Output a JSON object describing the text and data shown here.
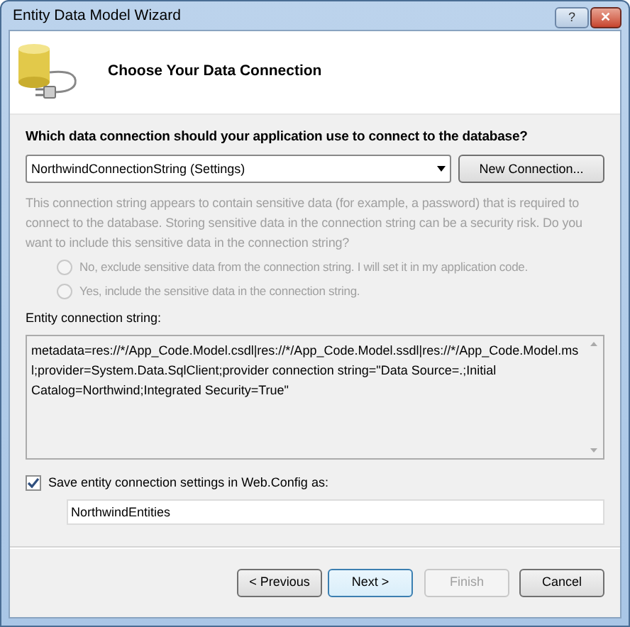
{
  "window": {
    "title": "Entity Data Model Wizard",
    "title_buttons": [
      {
        "label": "?",
        "kind": "help"
      },
      {
        "label": "✕",
        "kind": "close"
      }
    ]
  },
  "header": {
    "title": "Choose Your Data Connection"
  },
  "question": "Which data connection should your application use to connect to the database?",
  "connection": {
    "value": "NorthwindConnectionString (Settings)",
    "button": "New Connection..."
  },
  "sensitive": {
    "disabled": true,
    "text": "This connection string appears to contain sensitive data (for example, a password) that is required to connect to the database. Storing sensitive data in the connection string can be a security risk. Do you want to include this sensitive data in the connection string?",
    "options": [
      {
        "label": "No, exclude sensitive data from the connection string. I will set it in my application code.",
        "selected": false
      },
      {
        "label": "Yes, include the sensitive data in the connection string.",
        "selected": false
      }
    ]
  },
  "entity_label": "Entity connection string:",
  "entity_string": "metadata=res://*/App_Code.Model.csdl|res://*/App_Code.Model.ssdl|res://*/App_Code.Model.msl;provider=System.Data.SqlClient;provider connection string=\"Data Source=.;Initial Catalog=Northwind;Integrated Security=True\"",
  "save": {
    "label": "Save entity connection settings in Web.Config as:",
    "checked": true,
    "value": "NorthwindEntities"
  },
  "buttons": [
    {
      "label": "< Previous",
      "disabled": false,
      "default": false
    },
    {
      "label": "Next >",
      "disabled": false,
      "default": true
    },
    {
      "label": "Finish",
      "disabled": true,
      "default": false
    },
    {
      "label": "Cancel",
      "disabled": false,
      "default": false
    }
  ]
}
